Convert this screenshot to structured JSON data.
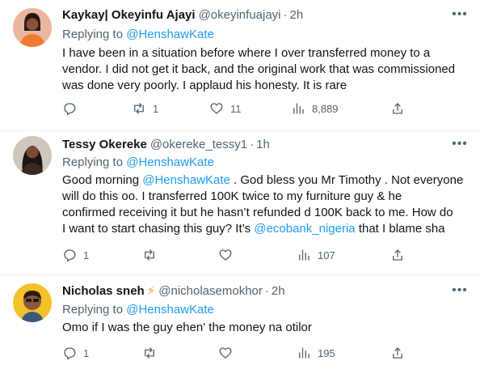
{
  "replying_prefix": "Replying to",
  "tweets": [
    {
      "name": "Kaykay| Okeyinfu Ajayi",
      "handle": "@okeyinfuajayi",
      "time": "2h",
      "replying_to": "@HenshawKate",
      "text_lines": [
        "I have been in a situation before where I over transferred money to a",
        "vendor. I did not get it back, and the original work that was commissioned",
        "was done very poorly. I applaud his honesty. It is rare"
      ],
      "replies": "",
      "retweets": "1",
      "likes": "11",
      "views": "8,889"
    },
    {
      "name": "Tessy Okereke",
      "handle": "@okereke_tessy1",
      "time": "1h",
      "replying_to": "@HenshawKate",
      "text_parts": {
        "l1_a": "Good morning ",
        "l1_mention": "@HenshawKate",
        "l1_b": " . God bless you Mr Timothy . Not everyone",
        "l2": "will do this oo. I transferred 100K twice to my furniture guy & he",
        "l3": "confirmed receiving it but he hasn’t refunded d 100K back to me. How do",
        "l4_a": "I want to start chasing this guy? It’s ",
        "l4_mention": "@ecobank_nigeria",
        "l4_b": " that I blame sha"
      },
      "replies": "1",
      "retweets": "",
      "likes": "",
      "views": "107"
    },
    {
      "name": "Nicholas sneh",
      "badge": "⚡",
      "handle": "@nicholasemokhor",
      "time": "2h",
      "replying_to": "@HenshawKate",
      "text": "Omo if I was the guy ehen' the money na otilor",
      "replies": "1",
      "retweets": "",
      "likes": "",
      "views": "195"
    }
  ],
  "icons": {
    "reply": "reply-icon",
    "retweet": "retweet-icon",
    "like": "heart-icon",
    "views": "views-icon",
    "share": "share-icon",
    "more": "more-icon"
  }
}
